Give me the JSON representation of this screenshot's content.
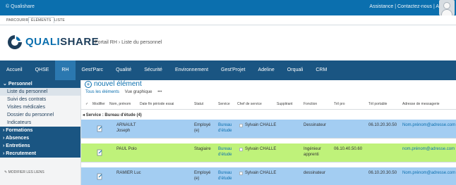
{
  "topbar": {
    "brand": "© Qualishare",
    "right_text": "Assistance | Contactez-nous | A"
  },
  "ribbon": {
    "tabs": [
      "PARCOURIR",
      "ÉLÉMENTS",
      "LISTE"
    ]
  },
  "header": {
    "logo_strong": "QUALI",
    "logo_light": "SHARE",
    "breadcrumb": "Portail RH  ›  Liste du personnel"
  },
  "nav": {
    "items": [
      "Accueil",
      "QHSE",
      "RH",
      "Gest'Parc",
      "Qualité",
      "Sécurité",
      "Environnement",
      "Gest'Projet",
      "Adeline",
      "Orquali",
      "CRM"
    ],
    "active": "RH"
  },
  "sidebar": {
    "personnel_head": "Personnel",
    "personnel_items": [
      "Liste du personnel",
      "Suivi des contrats",
      "Visites médicales",
      "Dossier du personnel",
      "Indicateurs"
    ],
    "formations": "Formations",
    "absences": "Absences",
    "entretiens": "Entretiens",
    "recrutement": "Recrutement",
    "edit_links": "MODIFIER LES LIENS"
  },
  "content": {
    "new_item": "nouvel élément",
    "view_all": "Tous les éléments",
    "view_graph": "Vue graphique",
    "view_more": "•••",
    "columns": [
      "✓",
      "Modifier",
      "Nom, prénom",
      "Date fin période essai",
      "Statut",
      "Service",
      "Chef de service",
      "Suppléant",
      "Fonction",
      "Tél pro",
      "Tél portable",
      "Adresse de messagerie"
    ],
    "group_label": "Service : Bureau d'étude (4)",
    "rows": [
      {
        "name_l1": "ARNAULT",
        "name_l2": "Joseph",
        "statut_l1": "Employé",
        "statut_l2": "(e)",
        "service_l1": "Bureau",
        "service_l2": "d'étude",
        "chef": "Sylvain CHALLE",
        "fonction_l1": "Dessinateur",
        "fonction_l2": "",
        "tel_pro": "",
        "tel_portable": "06.10.20.30.50",
        "email": "Nom.prénom@adresse.com"
      },
      {
        "name_l1": "PAUL Polo",
        "name_l2": "",
        "statut_l1": "Stagiaire",
        "statut_l2": "",
        "service_l1": "Bureau",
        "service_l2": "d'étude",
        "chef": "Sylvain CHALLE",
        "fonction_l1": "Ingénieur",
        "fonction_l2": "apprenti",
        "tel_pro": "06.10.40.50.60",
        "tel_portable": "",
        "email": "nom.prénom@adresse.com"
      },
      {
        "name_l1": "RAMIER Luc",
        "name_l2": "",
        "statut_l1": "Employé",
        "statut_l2": "(e)",
        "service_l1": "Bureau",
        "service_l2": "d'étude",
        "chef": "Sylvain CHALLE",
        "fonction_l1": "dessinateur",
        "fonction_l2": "",
        "tel_pro": "",
        "tel_portable": "06.10.20.30.50",
        "email": "Nom.prénom@adresse.com"
      }
    ],
    "row_colors": [
      "#a3cdf2",
      "#bff27a",
      "#a3cdf2"
    ]
  },
  "colors": {
    "brand_blue": "#0b6fae",
    "nav_dark": "#1a5582",
    "nav_active": "#2b78b0"
  }
}
